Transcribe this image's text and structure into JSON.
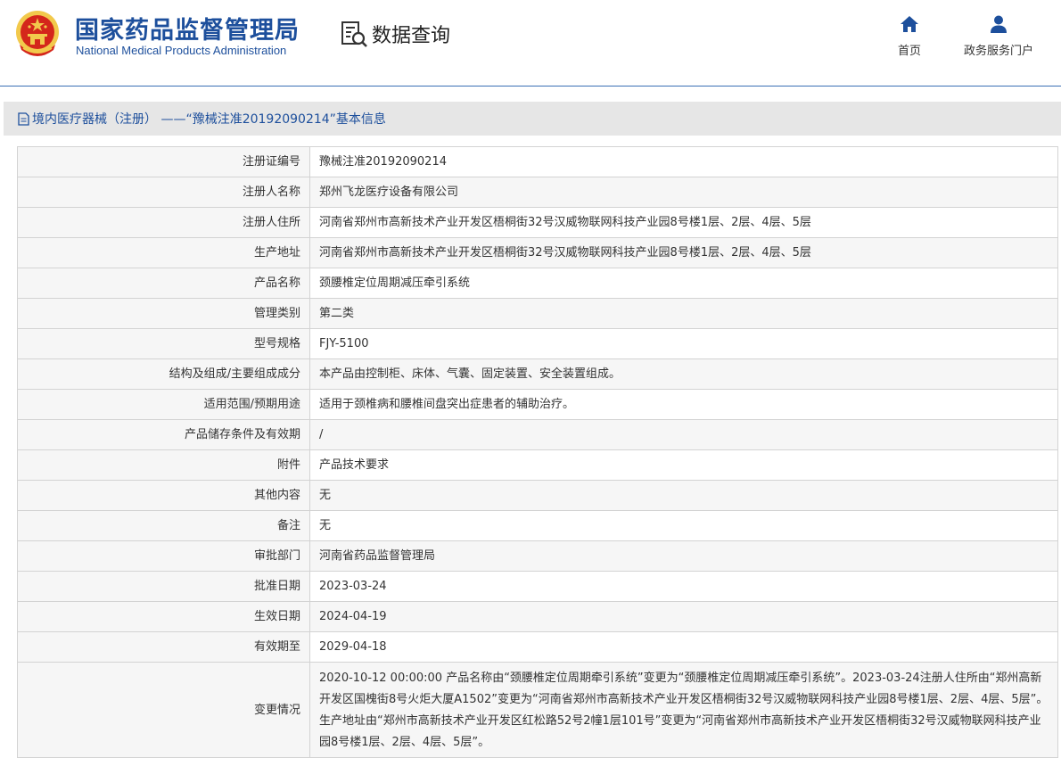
{
  "header": {
    "org_name_cn": "国家药品监督管理局",
    "org_name_en": "National Medical Products Administration",
    "query_label": "数据查询",
    "nav": [
      {
        "label": "首页",
        "icon": "home-icon"
      },
      {
        "label": "政务服务门户",
        "icon": "user-icon"
      }
    ]
  },
  "title": "境内医疗器械（注册） ——“豫械注准20192090214”基本信息",
  "colors": {
    "brand_blue": "#1d4f9c",
    "title_bg": "#e6e6e6",
    "label_bg": "#f6f6f6",
    "border": "#d3d3d3"
  },
  "rows": [
    {
      "label": "注册证编号",
      "value": "豫械注准20192090214"
    },
    {
      "label": "注册人名称",
      "value": "郑州飞龙医疗设备有限公司"
    },
    {
      "label": "注册人住所",
      "value": "河南省郑州市高新技术产业开发区梧桐街32号汉威物联网科技产业园8号楼1层、2层、4层、5层"
    },
    {
      "label": "生产地址",
      "value": "河南省郑州市高新技术产业开发区梧桐街32号汉威物联网科技产业园8号楼1层、2层、4层、5层"
    },
    {
      "label": "产品名称",
      "value": "颈腰椎定位周期减压牵引系统"
    },
    {
      "label": "管理类别",
      "value": "第二类"
    },
    {
      "label": "型号规格",
      "value": "FJY-5100"
    },
    {
      "label": "结构及组成/主要组成成分",
      "value": "本产品由控制柜、床体、气囊、固定装置、安全装置组成。"
    },
    {
      "label": "适用范围/预期用途",
      "value": "适用于颈椎病和腰椎间盘突出症患者的辅助治疗。"
    },
    {
      "label": "产品储存条件及有效期",
      "value": "/"
    },
    {
      "label": "附件",
      "value": "产品技术要求"
    },
    {
      "label": "其他内容",
      "value": "无"
    },
    {
      "label": "备注",
      "value": "无"
    },
    {
      "label": "审批部门",
      "value": "河南省药品监督管理局"
    },
    {
      "label": "批准日期",
      "value": "2023-03-24"
    },
    {
      "label": "生效日期",
      "value": "2024-04-19"
    },
    {
      "label": "有效期至",
      "value": "2029-04-18"
    },
    {
      "label": "变更情况",
      "value": "2020-10-12 00:00:00 产品名称由“颈腰椎定位周期牵引系统”变更为“颈腰椎定位周期减压牵引系统”。2023-03-24注册人住所由“郑州高新开发区国槐街8号火炬大厦A1502”变更为“河南省郑州市高新技术产业开发区梧桐街32号汉威物联网科技产业园8号楼1层、2层、4层、5层”。生产地址由“郑州市高新技术产业开发区红松路52号2幢1层101号”变更为“河南省郑州市高新技术产业开发区梧桐街32号汉威物联网科技产业园8号楼1层、2层、4层、5层”。"
    }
  ]
}
